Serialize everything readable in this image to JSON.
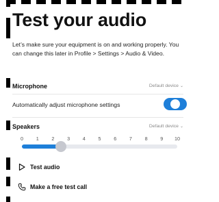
{
  "title": "Test your audio",
  "description": "Let’s make sure your equipment is on and working properly. You can change this later in Profile > Settings > Audio & Video.",
  "microphone": {
    "label": "Microphone",
    "device": "Default device",
    "auto_adjust_label": "Automatically adjust microphone settings",
    "auto_adjust_on": true
  },
  "speakers": {
    "label": "Speakers",
    "device": "Default device",
    "ticks": [
      "0",
      "1",
      "2",
      "3",
      "4",
      "5",
      "6",
      "7",
      "8",
      "9",
      "10"
    ],
    "volume": 2.5,
    "volume_max": 10
  },
  "actions": {
    "test_audio": "Test audio",
    "test_call": "Make a free test call"
  },
  "colors": {
    "accent": "#1e7fd9",
    "thumb": "#c6c8cf"
  }
}
